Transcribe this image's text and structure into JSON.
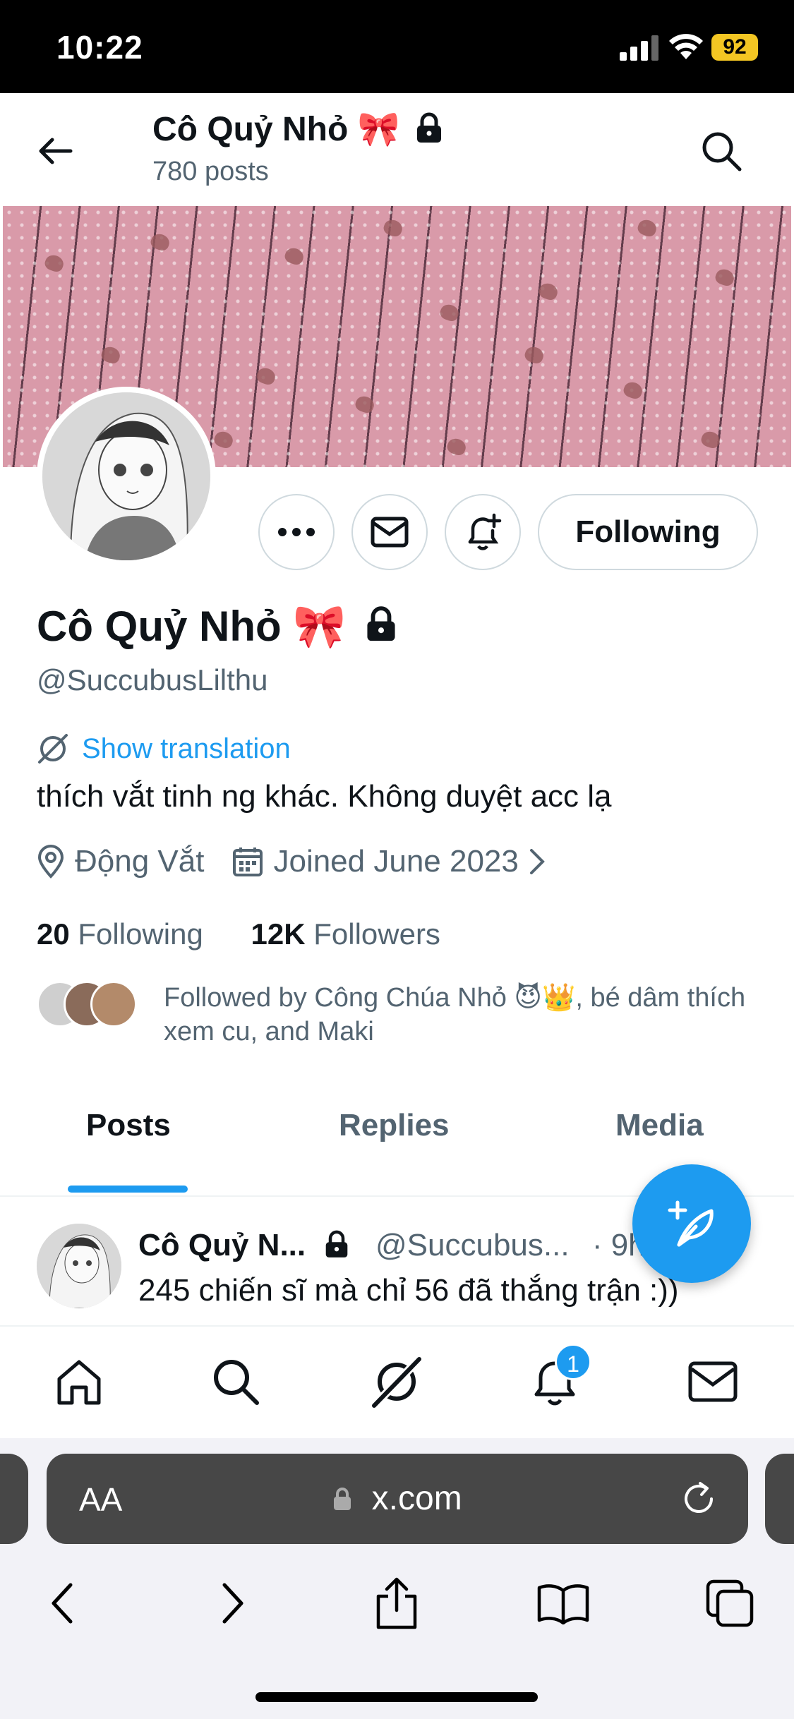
{
  "status_bar": {
    "time": "10:22",
    "battery": "92"
  },
  "header": {
    "title": "Cô Quỷ Nhỏ 🎀",
    "posts_count": "780 posts"
  },
  "profile": {
    "display_name": "Cô Quỷ Nhỏ 🎀",
    "handle": "@SuccubusLilthu",
    "show_translation": "Show translation",
    "bio": "thích vắt tinh ng khác. Không duyệt acc lạ",
    "location": "Động Vắt",
    "joined": "Joined June 2023",
    "following_count": "20",
    "following_label": "Following",
    "followers_count": "12K",
    "followers_label": "Followers",
    "followed_by": "Followed by Công Chúa Nhỏ 😈👑, bé dâm thích xem cu, and Maki",
    "follow_button": "Following"
  },
  "tabs": [
    {
      "label": "Posts"
    },
    {
      "label": "Replies"
    },
    {
      "label": "Media"
    }
  ],
  "post": {
    "name": "Cô Quỷ N...",
    "handle": "@Succubus...",
    "time": "· 9h",
    "text": "245 chiến sĩ mà chỉ 56 đã thắng trận :))"
  },
  "bottom_nav": {
    "notifications_badge": "1"
  },
  "browser": {
    "aa": "AA",
    "url": "x.com"
  },
  "colors": {
    "accent": "#1d9bf0",
    "secondary_text": "#536471"
  }
}
